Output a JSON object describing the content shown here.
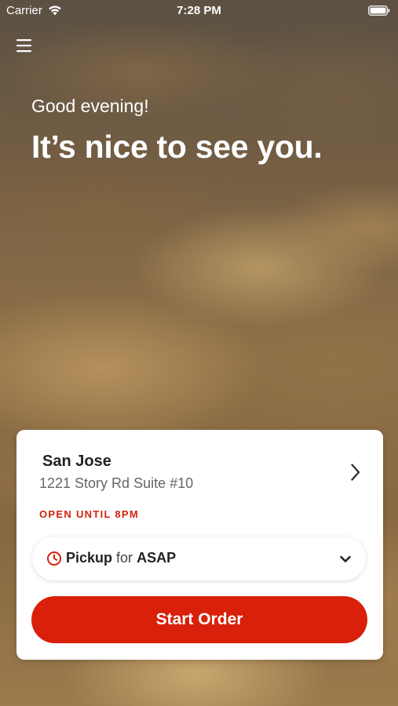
{
  "status_bar": {
    "carrier": "Carrier",
    "time": "7:28 PM",
    "icons": [
      "wifi-icon",
      "battery-icon"
    ]
  },
  "menu": {
    "icon": "hamburger-menu-icon"
  },
  "greeting": {
    "salutation": "Good evening!",
    "headline": "It’s nice to see you."
  },
  "store": {
    "name": "San Jose",
    "address": "1221 Story Rd Suite #10",
    "hours": "OPEN UNTIL 8PM",
    "icon": "chevron-right-icon"
  },
  "order_mode": {
    "mode": "Pickup",
    "connector": "for",
    "time": "ASAP",
    "icon": "clock-icon",
    "dropdown_icon": "chevron-down-icon"
  },
  "actions": {
    "start_order": "Start Order"
  },
  "colors": {
    "accent": "#d8200b",
    "hours_text": "#d4210e",
    "card_background": "#ffffff",
    "text_primary": "#222222",
    "text_secondary": "#666666"
  }
}
